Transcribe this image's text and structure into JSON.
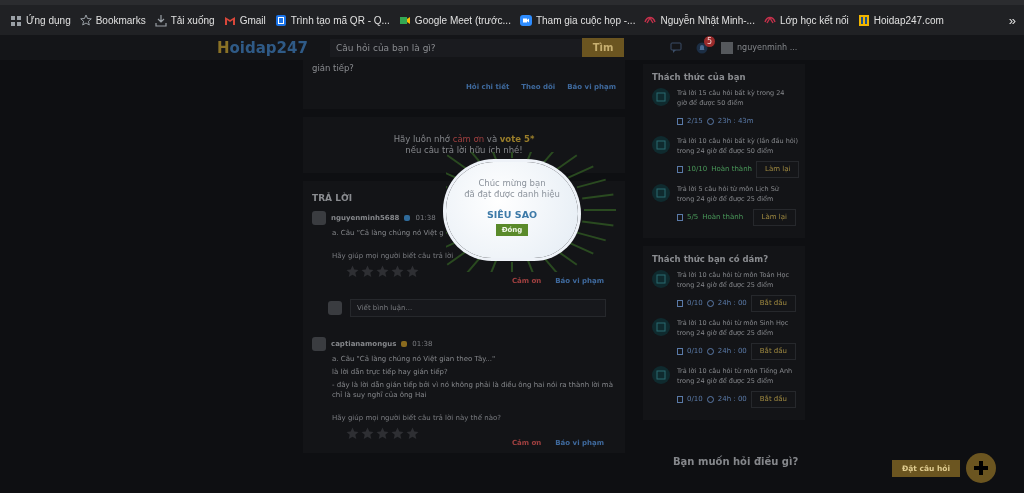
{
  "bookmarks": [
    {
      "kind": "apps",
      "label": "Ứng dụng"
    },
    {
      "kind": "star",
      "label": "Bookmarks"
    },
    {
      "kind": "download",
      "label": "Tải xuống"
    },
    {
      "kind": "gmail",
      "label": "Gmail"
    },
    {
      "kind": "qr",
      "label": "Trình tạo mã QR - Q..."
    },
    {
      "kind": "meet",
      "label": "Google Meet (trước..."
    },
    {
      "kind": "video",
      "label": "Tham gia cuộc họp -..."
    },
    {
      "kind": "site",
      "label": "Nguyễn Nhật Minh-..."
    },
    {
      "kind": "site",
      "label": "Lớp học kết nối"
    },
    {
      "kind": "hoidap",
      "label": "Hoidap247.com"
    }
  ],
  "bookmarks_more": "»",
  "header": {
    "logo_initial": "H",
    "logo_rest": "oidap247",
    "search_placeholder": "Câu hỏi của bạn là gì?",
    "search_button": "Tìm",
    "notification_count": "5",
    "username": "nguyenminh ..."
  },
  "question": {
    "text_tail": "gián tiếp?",
    "links": [
      "Hỏi chi tiết",
      "Theo dõi",
      "Báo vi phạm"
    ]
  },
  "reminder": {
    "line1": [
      {
        "kind": "plain",
        "text": "Hãy luôn nhớ "
      },
      {
        "kind": "thanks",
        "text": "cảm ơn"
      },
      {
        "kind": "plain",
        "text": " và "
      },
      {
        "kind": "vote",
        "text": "vote 5*"
      }
    ],
    "line2": "nếu câu trả lời hữu ích nhé!"
  },
  "answers_title": "TRẢ LỜI",
  "answers": [
    {
      "user": "nguyenminh5688",
      "color": "#2f6a9a",
      "time": "01:38",
      "lines": [
        "a. Câu “Cả làng chúng nó Việt g"
      ],
      "prompt": "Hãy giúp mọi người biết câu trả lời",
      "stars": 0,
      "thanks": "Cảm ơn",
      "report": "Báo vi phạm",
      "comment_placeholder": "Viết bình luận..."
    },
    {
      "user": "captianamongus",
      "color": "#8a6a1e",
      "time": "01:38",
      "lines": [
        "a. Câu \"Cả làng chúng nó Việt gian theo Tây...\"",
        "là lời dẫn trực tiếp hay gián tiếp?",
        "- đây là lời dẫn gián tiếp bởi vì nó không phải là điều ông hai nói ra thành lời mà chỉ là suy nghĩ của ông Hai"
      ],
      "prompt": "Hãy giúp mọi người biết câu trả lời này thế nào?",
      "stars": 0,
      "thanks": "Cảm ơn",
      "report": "Báo vi phạm"
    }
  ],
  "popup": {
    "line1": "Chúc mừng bạn",
    "line2": "đã đạt được danh hiệu",
    "title": "SIÊU SAO",
    "button": "Đóng"
  },
  "challenges": {
    "title": "Thách thức của bạn",
    "items": [
      {
        "text": "Trả lời 15 câu hỏi bất kỳ trong 24 giờ để được 50 điểm",
        "progress": "2/15",
        "completed": false,
        "time": "23h : 43m"
      },
      {
        "text": "Trả lời 10 câu hỏi bất kỳ (lần đầu hỏi) trong 24 giờ để được 50 điểm",
        "progress": "10/10",
        "completed": true,
        "status": "Hoàn thành",
        "button": "Làm lại"
      },
      {
        "text": "Trả lời 5 câu hỏi từ môn Lịch Sử trong 24 giờ để được 25 điểm",
        "progress": "5/5",
        "completed": true,
        "status": "Hoàn thành",
        "button": "Làm lại"
      }
    ]
  },
  "dare": {
    "title": "Thách thức bạn có dám?",
    "items": [
      {
        "text": "Trả lời 10 câu hỏi từ môn Toán Học trong 24 giờ để được 25 điểm",
        "progress": "0/10",
        "completed": false,
        "time": "24h : 00",
        "button": "Bắt đầu"
      },
      {
        "text": "Trả lời 10 câu hỏi từ môn Sinh Học trong 24 giờ để được 25 điểm",
        "progress": "0/10",
        "completed": false,
        "time": "24h : 00",
        "button": "Bắt đầu"
      },
      {
        "text": "Trả lời 10 câu hỏi từ môn Tiếng Anh trong 24 giờ để được 25 điểm",
        "progress": "0/10",
        "completed": false,
        "time": "24h : 00",
        "button": "Bắt đầu"
      }
    ]
  },
  "ask_title": "Bạn muốn hỏi điều gì?",
  "ask_button": "Đặt câu hỏi"
}
